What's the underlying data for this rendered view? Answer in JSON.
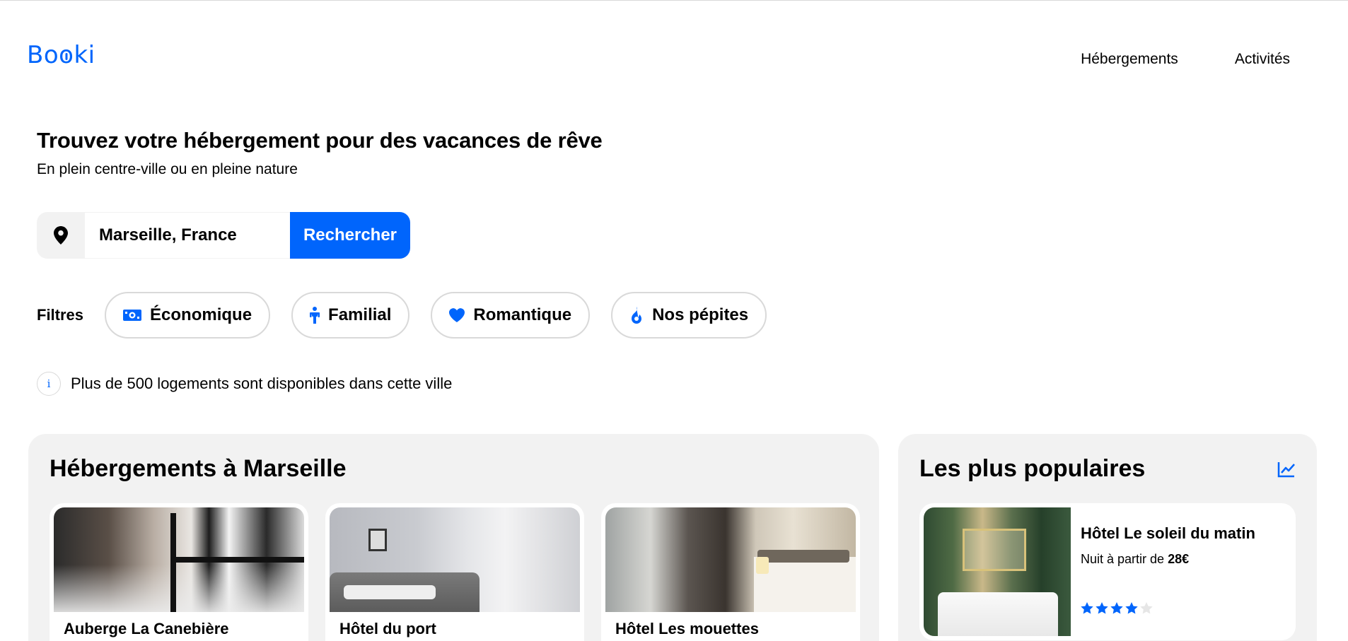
{
  "brand": {
    "logo_text": "Booki",
    "accent": "#0065fc"
  },
  "nav": {
    "items": [
      "Hébergements",
      "Activités"
    ]
  },
  "hero": {
    "title": "Trouvez votre hébergement pour des vacances de rêve",
    "subtitle": "En plein centre-ville ou en pleine nature"
  },
  "search": {
    "value": "Marseille, France",
    "button_label": "Rechercher",
    "icon": "location-pin-icon"
  },
  "filters": {
    "label": "Filtres",
    "items": [
      {
        "label": "Économique",
        "icon": "money-icon"
      },
      {
        "label": "Familial",
        "icon": "child-icon"
      },
      {
        "label": "Romantique",
        "icon": "heart-icon"
      },
      {
        "label": "Nos pépites",
        "icon": "fire-icon"
      }
    ]
  },
  "info": {
    "icon_text": "i",
    "text": "Plus de 500 logements sont disponibles dans cette ville"
  },
  "accommodations": {
    "title": "Hébergements à Marseille",
    "cards": [
      {
        "name": "Auberge La Canebière"
      },
      {
        "name": "Hôtel du port"
      },
      {
        "name": "Hôtel Les mouettes"
      }
    ]
  },
  "popular": {
    "title": "Les plus populaires",
    "icon": "trend-chart-icon",
    "cards": [
      {
        "name": "Hôtel Le soleil du matin",
        "price_prefix": "Nuit à partir de ",
        "price_value": "28€",
        "rating": 4,
        "rating_max": 5
      }
    ]
  }
}
